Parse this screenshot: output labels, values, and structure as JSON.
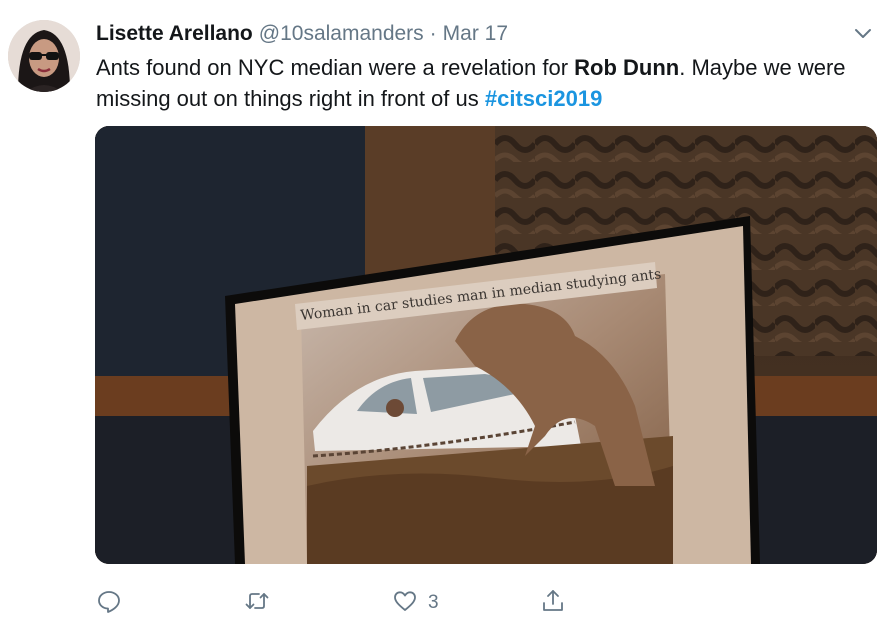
{
  "tweet": {
    "author_name": "Lisette Arellano",
    "handle": "@10salamanders",
    "separator": "·",
    "date": "Mar 17",
    "text_part1": "Ants found on NYC median were a revelation for ",
    "mention_bold": "Rob Dunn",
    "text_part2": ". Maybe we were missing out on things right in front of us ",
    "hashtag": "#citsci2019",
    "media": {
      "slide_caption": "Woman in car studies man in median studying ants"
    },
    "actions": {
      "reply_icon": "reply-icon",
      "retweet_icon": "retweet-icon",
      "like_icon": "heart-icon",
      "like_count": "3",
      "share_icon": "share-icon"
    }
  },
  "colors": {
    "link": "#1b95e0",
    "secondary_text": "#657786",
    "primary_text": "#14171a"
  }
}
